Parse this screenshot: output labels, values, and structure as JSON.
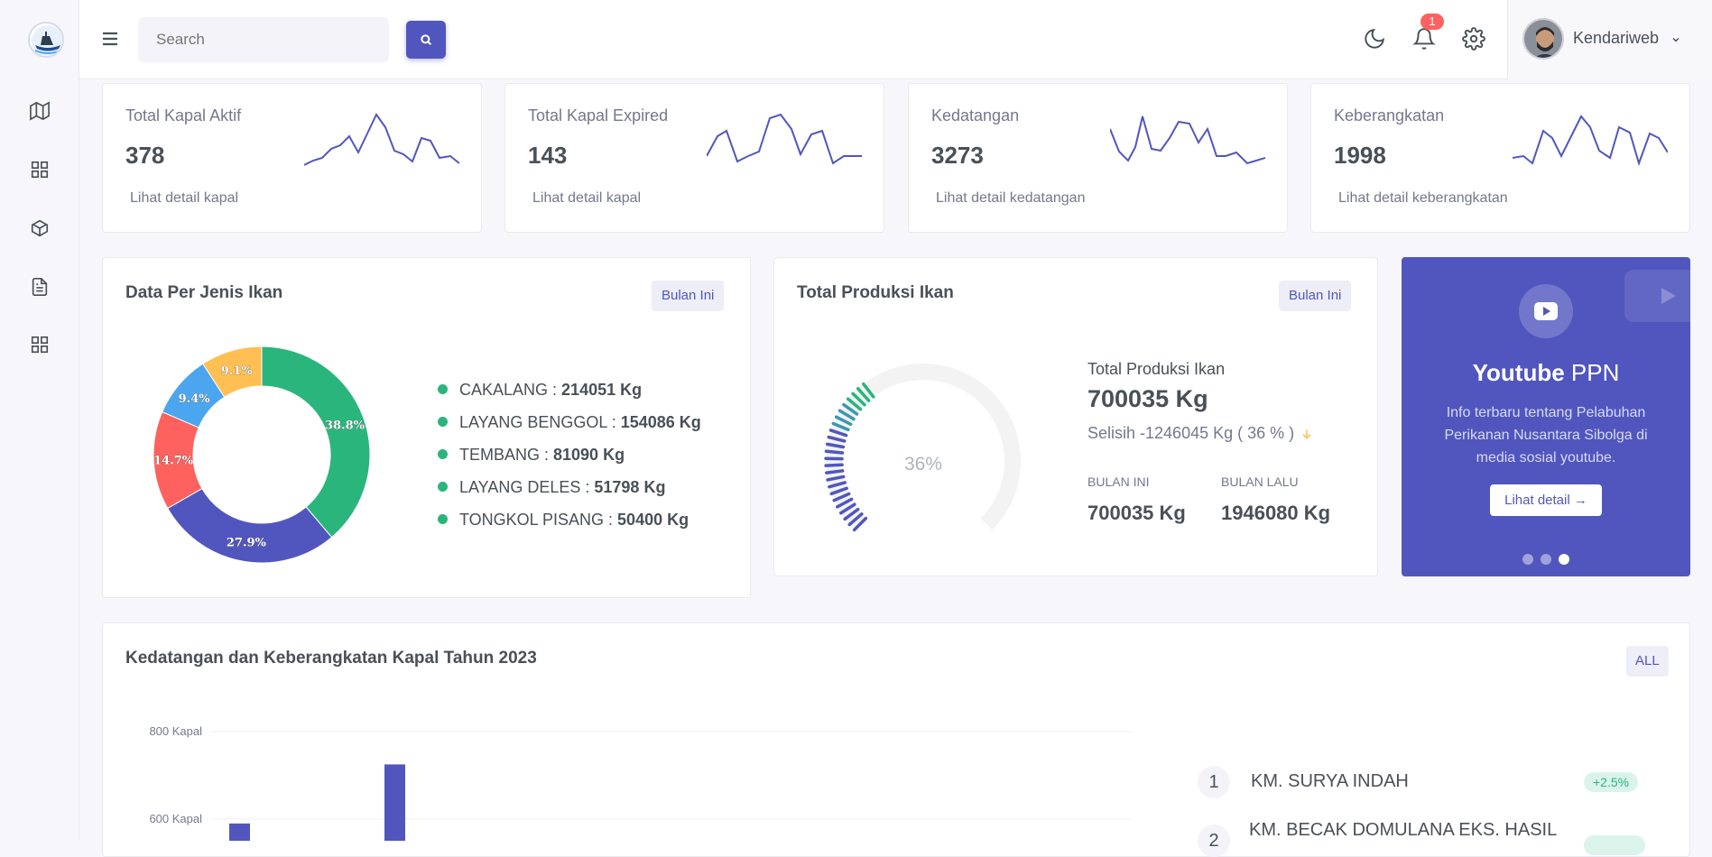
{
  "sidebar": {
    "logo_alt": "PPN Sibolga",
    "icons": [
      "map-icon",
      "grid-icon",
      "box-icon",
      "file-text-icon",
      "apps-icon"
    ]
  },
  "topbar": {
    "search_placeholder": "Search",
    "notification_count": "1",
    "user_name": "Kendariweb"
  },
  "stats": [
    {
      "title": "Total Kapal Aktif",
      "value": "378",
      "link": "Lihat detail kapal"
    },
    {
      "title": "Total Kapal Expired",
      "value": "143",
      "link": "Lihat detail kapal"
    },
    {
      "title": "Kedatangan",
      "value": "3273",
      "link": "Lihat detail kedatangan"
    },
    {
      "title": "Keberangkatan",
      "value": "1998",
      "link": "Lihat detail keberangkatan"
    }
  ],
  "jenis_ikan": {
    "title": "Data Per Jenis Ikan",
    "filter": "Bulan Ini",
    "legend": [
      {
        "name": "CAKALANG : ",
        "value": "214051 Kg"
      },
      {
        "name": "LAYANG BENGGOL : ",
        "value": "154086 Kg"
      },
      {
        "name": "TEMBANG : ",
        "value": "81090 Kg"
      },
      {
        "name": "LAYANG DELES : ",
        "value": "51798 Kg"
      },
      {
        "name": "TONGKOL PISANG : ",
        "value": "50400 Kg"
      }
    ]
  },
  "produksi": {
    "title": "Total Produksi Ikan",
    "filter": "Bulan Ini",
    "gauge_label": "36%",
    "label": "Total Produksi Ikan",
    "total": "700035 Kg",
    "selisih": "Selisih -1246045 Kg ( 36 % )",
    "bulan_ini_label": "BULAN INI",
    "bulan_ini_value": "700035 Kg",
    "bulan_lalu_label": "BULAN LALU",
    "bulan_lalu_value": "1946080 Kg"
  },
  "promo": {
    "title_bold": "Youtube",
    "title_rest": " PPN",
    "text": "Info terbaru tentang Pelabuhan Perikanan Nusantara Sibolga di media sosial youtube.",
    "button": "Lihat detail"
  },
  "kapal": {
    "title": "Kedatangan dan Keberangkatan Kapal Tahun 2023",
    "filter": "ALL",
    "list": [
      {
        "rank": "1",
        "name": "KM. SURYA INDAH",
        "pct": "+2.5%"
      },
      {
        "rank": "2",
        "name": "KM. BECAK DOMULANA EKS. HASIL",
        "pct": ""
      }
    ]
  },
  "chart_data": [
    {
      "type": "pie",
      "title": "Data Per Jenis Ikan",
      "labels": [
        "CAKALANG",
        "LAYANG BENGGOL",
        "TEMBANG",
        "LAYANG DELES",
        "TONGKOL PISANG"
      ],
      "values": [
        214051,
        154086,
        81090,
        51798,
        50400
      ],
      "slice_labels": [
        "38.8%",
        "27.9%",
        "14.7%",
        "9.4%",
        "9.1%"
      ],
      "colors": [
        "#2ab57d",
        "#5156be",
        "#fd625e",
        "#4ba6ef",
        "#ffbf53"
      ]
    },
    {
      "type": "bar",
      "title": "Kedatangan dan Keberangkatan Kapal Tahun 2023",
      "ytick_labels": [
        "800 Kapal",
        "600 Kapal"
      ],
      "ylim_visible": [
        600,
        800
      ],
      "values_visible": [
        590,
        725
      ],
      "color": "#5156be"
    }
  ],
  "colors": {
    "primary": "#5156be",
    "success": "#2ab57d",
    "danger": "#fd625e",
    "info": "#4ba6ef",
    "warning": "#ffbf53"
  }
}
